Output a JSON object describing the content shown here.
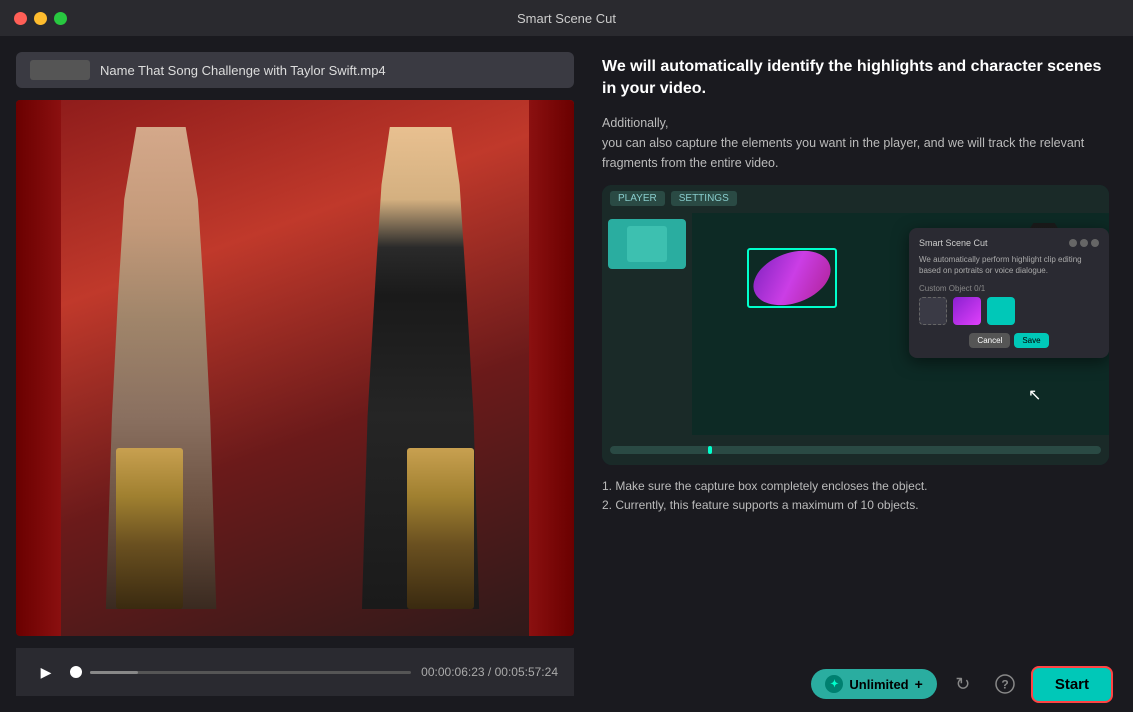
{
  "titlebar": {
    "title": "Smart Scene Cut"
  },
  "traffic_lights": {
    "red": "#ff5f57",
    "yellow": "#febc2e",
    "green": "#28c840"
  },
  "left_panel": {
    "file_name": "Name That Song Challenge with Taylor Swift.mp4",
    "current_time": "00:00:06:23",
    "total_time": "/ 05:57:24",
    "time_separator": "/",
    "progress_percent": 15
  },
  "right_panel": {
    "heading": "We will automatically identify the highlights and character scenes in your video.",
    "additionally_label": "Additionally,",
    "sub_description": "you can also capture the elements you want in the player, and we will track the relevant fragments from the entire video.",
    "note_1": "1. Make sure the capture box completely encloses the object.",
    "note_2": "2. Currently, this feature supports a maximum of 10 objects.",
    "preview": {
      "toolbar_tab1": "PLAYER",
      "toolbar_tab2": "SETTINGS",
      "dialog": {
        "title": "Smart Scene Cut",
        "body": "We automatically perform highlight clip editing based on portraits or voice dialogue.",
        "custom_object_label": "Custom Object  0/1",
        "cancel_label": "Cancel",
        "save_label": "Save"
      }
    }
  },
  "bottom_bar": {
    "credits_label": "Unlimited",
    "credits_plus": "+",
    "refresh_icon": "↻",
    "help_icon": "?",
    "start_label": "Start"
  },
  "controls": {
    "play_icon": "▶",
    "time_current": "00:00:06:23",
    "time_separator": "/",
    "time_total": "00:05:57:24"
  }
}
